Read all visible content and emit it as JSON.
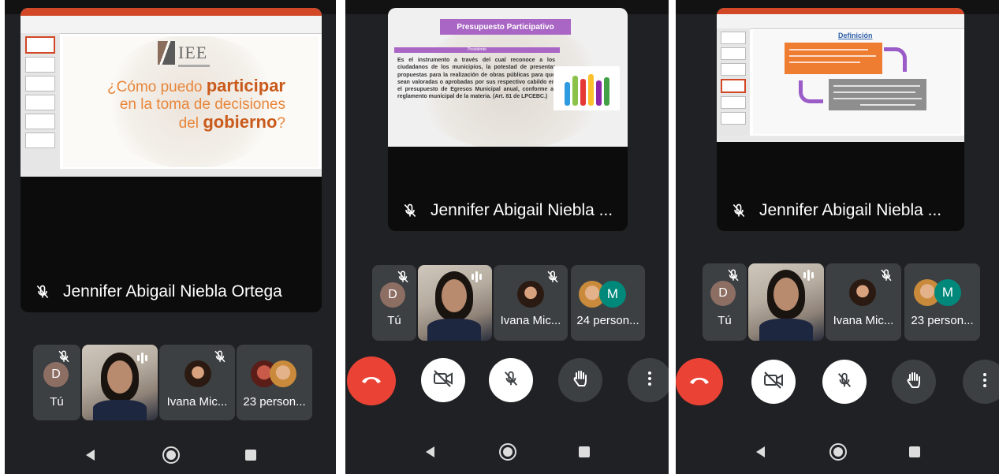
{
  "screen1": {
    "presenter_name": "Jennifer Abigail Niebla Ortega",
    "slide": {
      "logo_text": "IEE",
      "question_line1_a": "¿Cómo puedo ",
      "question_line1_b": "participar",
      "question_line2": "en la toma de decisiones",
      "question_line3_a": "del ",
      "question_line3_b": "gobierno",
      "question_line3_c": "?"
    },
    "tiles": [
      {
        "avatar_letter": "D",
        "label": "Tú",
        "muted": true
      },
      {
        "label": "",
        "speaking": true
      },
      {
        "label": "Ivana Mic...",
        "muted": true
      },
      {
        "label": "23 person..."
      }
    ]
  },
  "screen2": {
    "presenter_name": "Jennifer Abigail Niebla ...",
    "slide": {
      "title": "Presupuesto Participativo",
      "subtitle": "Presidente",
      "body": "Es el instrumento a través del cual reconoce a los ciudadanos de los municipios, la potestad de presentar propuestas para la realización de obras públicas para que sean valoradas o aprobadas por sus respectivo cabildo en el presupuesto de Egresos Municipal anual, conforme al reglamento municipal de la materia. (Art. 81 de LPCEBC.)"
    },
    "tiles": [
      {
        "avatar_letter": "D",
        "label": "Tú",
        "muted": true
      },
      {
        "label": "",
        "speaking": true
      },
      {
        "label": "Ivana Mic...",
        "muted": true
      },
      {
        "label": "24 person...",
        "avatar_letter": "M"
      }
    ]
  },
  "screen3": {
    "presenter_name": "Jennifer Abigail Niebla ...",
    "slide": {
      "title": "Definición"
    },
    "tiles": [
      {
        "avatar_letter": "D",
        "label": "Tú",
        "muted": true
      },
      {
        "label": "",
        "speaking": true
      },
      {
        "label": "Ivana Mic...",
        "muted": true
      },
      {
        "label": "23 person...",
        "avatar_letter": "M"
      }
    ]
  },
  "colors": {
    "background": "#202124",
    "tile": "#3c4043",
    "end_call": "#ea4335",
    "avatar_d": "#8d6e63",
    "avatar_m": "#00897b",
    "slide_purple": "#a966c4",
    "slide_orange": "#ee7d31"
  },
  "icons": [
    "mic-off-icon",
    "end-call-icon",
    "video-off-icon",
    "raise-hand-icon",
    "more-vert-icon",
    "back-nav-icon",
    "home-nav-icon",
    "recents-nav-icon",
    "audio-bars-icon"
  ]
}
